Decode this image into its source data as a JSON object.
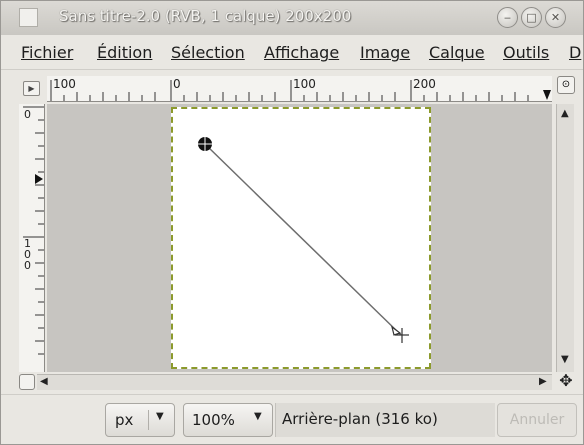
{
  "window": {
    "title": "Sans titre-2.0 (RVB, 1 calque) 200x200"
  },
  "menubar": {
    "items": [
      "Fichier",
      "Édition",
      "Sélection",
      "Affichage",
      "Image",
      "Calque",
      "Outils",
      "D"
    ]
  },
  "rulers": {
    "horizontal_labels": [
      "100",
      "0",
      "100",
      "200"
    ],
    "vertical_labels": [
      "0",
      "100"
    ]
  },
  "statusbar": {
    "unit": "px",
    "zoom": "100%",
    "layer_info": "Arrière-plan (316 ko)",
    "cancel_label": "Annuler"
  },
  "colors": {
    "selection_border": "#8c9a2c",
    "canvas_bg": "#ffffff",
    "workspace_bg": "#c7c5c1"
  },
  "icons": {
    "close": "close-icon",
    "maximize": "maximize-icon",
    "minimize": "minimize-icon",
    "navigate": "navigate-icon",
    "zoom": "zoom-icon",
    "quick-mask": "quick-mask-icon"
  }
}
